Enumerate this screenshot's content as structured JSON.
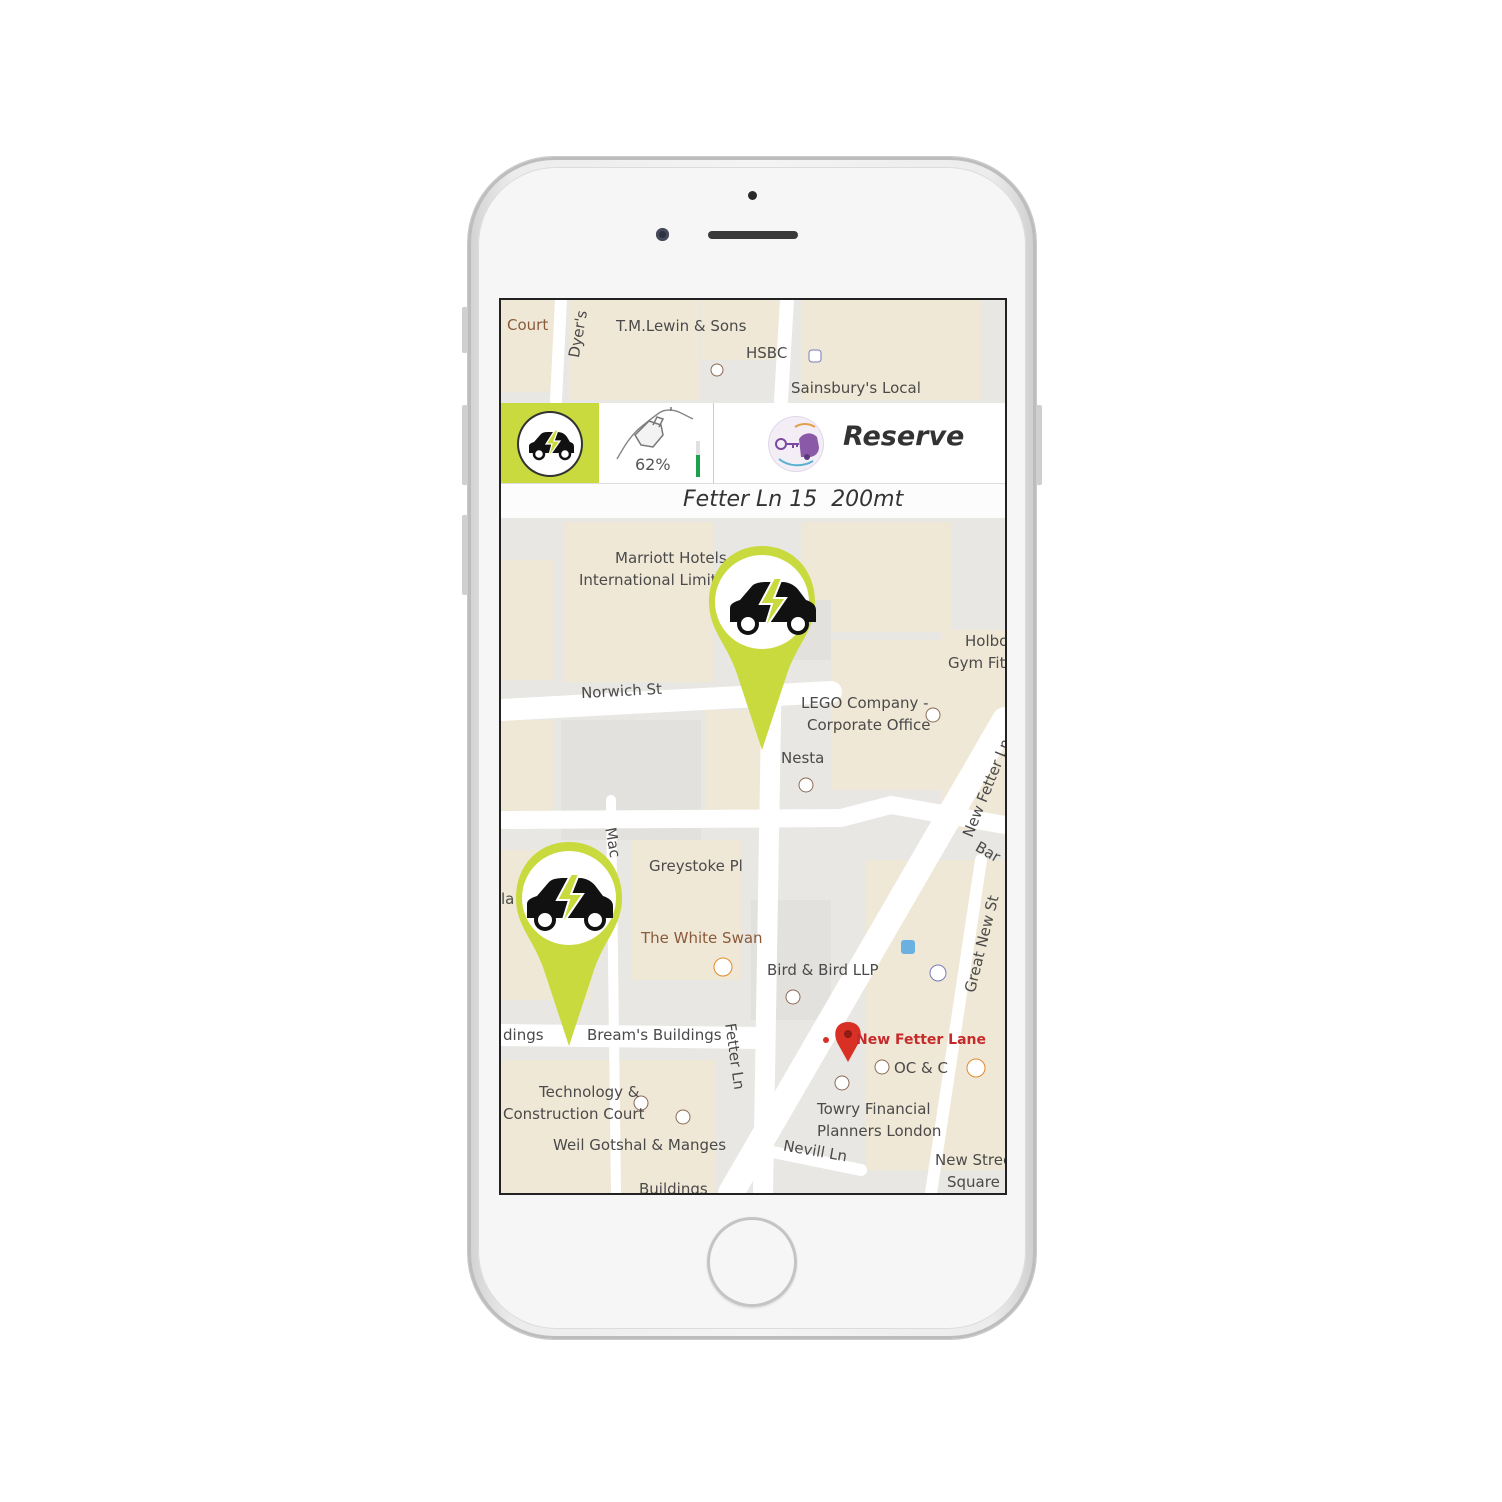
{
  "app": {
    "accent_color": "#c8da3d",
    "charge_level": {
      "label": "62%",
      "value": 0.62
    },
    "reserve_label": "Reserve",
    "address_label": "Fetter Ln 15  200mt"
  },
  "icons": {
    "ev_car": "ev-car-icon",
    "fuel_pump": "fuel-pump-icon",
    "reserve": "key-car-icon",
    "map_pin": "map-pin-icon"
  },
  "map": {
    "labels": {
      "court": "Court",
      "dyers": "Dyer's",
      "tm_lewin": "T.M.Lewin & Sons",
      "hsbc": "HSBC",
      "sainsburys": "Sainsbury's Local",
      "marriott_1": "Marriott Hotels",
      "marriott_2": "International Limited",
      "holborn_1": "Holbo",
      "holborn_2": "Gym Fitr",
      "norwich": "Norwich St",
      "lego_1": "LEGO Company -",
      "lego_2": "Corporate Office",
      "nesta": "Nesta",
      "new_fetter_ln": "New Fetter Ln",
      "bar": "Bar",
      "great_new_st": "Great New St",
      "greystoke": "Greystoke Pl",
      "white_swan": "The White Swan",
      "bird_bird": "Bird & Bird LLP",
      "new_fetter_lane": "New Fetter Lane",
      "oc_c": "OC & C",
      "dings": "dings",
      "breams": "Bream's Buildings",
      "fetter_ln": "Fetter Ln",
      "tech_1": "Technology &",
      "tech_2": "Construction Court",
      "weil": "Weil Gotshal & Manges",
      "towry_1": "Towry Financial",
      "towry_2": "Planners London",
      "nevill": "Nevill Ln",
      "new_street_1": "New Stree",
      "new_street_2": "Square",
      "buildings_bottom": "Buildings",
      "la": "la",
      "mac": "Mac"
    }
  }
}
